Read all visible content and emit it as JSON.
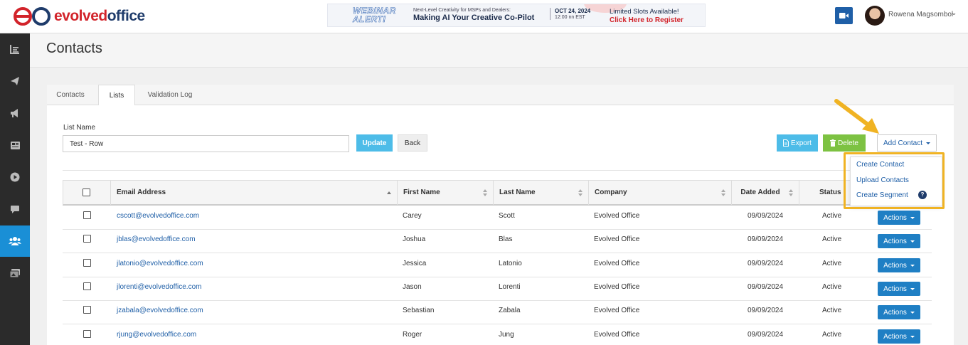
{
  "brand": {
    "part1": "evolved",
    "part2": "office"
  },
  "banner": {
    "alert_line1": "WEBINAR",
    "alert_line2": "ALERT!",
    "small_text": "Next-Level Creativity for MSPs and Dealers:",
    "headline": "Making AI Your Creative Co-Pilot",
    "date": "OCT 24, 2024",
    "time": "12:00 nn EST",
    "slots": "Limited Slots Available!",
    "cta": "Click Here to Register"
  },
  "user": {
    "name": "Rowena Magsombol"
  },
  "page": {
    "title": "Contacts"
  },
  "tabs": [
    {
      "label": "Contacts"
    },
    {
      "label": "Lists"
    },
    {
      "label": "Validation Log"
    }
  ],
  "form": {
    "list_name_label": "List Name",
    "list_name_value": "Test - Row",
    "update_label": "Update",
    "back_label": "Back"
  },
  "toolbar": {
    "export_label": "Export",
    "delete_label": "Delete",
    "add_contact_label": "Add Contact"
  },
  "dropdown": {
    "items": [
      {
        "label": "Create Contact"
      },
      {
        "label": "Upload Contacts"
      },
      {
        "label": "Create Segment"
      }
    ],
    "help": "?"
  },
  "table": {
    "columns": {
      "email": "Email Address",
      "first": "First Name",
      "last": "Last Name",
      "company": "Company",
      "date": "Date Added",
      "status": "Status"
    },
    "action_label": "Actions",
    "rows": [
      {
        "email": "cscott@evolvedoffice.com",
        "first": "Carey",
        "last": "Scott",
        "company": "Evolved Office",
        "date": "09/09/2024",
        "status": "Active"
      },
      {
        "email": "jblas@evolvedoffice.com",
        "first": "Joshua",
        "last": "Blas",
        "company": "Evolved Office",
        "date": "09/09/2024",
        "status": "Active"
      },
      {
        "email": "jlatonio@evolvedoffice.com",
        "first": "Jessica",
        "last": "Latonio",
        "company": "Evolved Office",
        "date": "09/09/2024",
        "status": "Active"
      },
      {
        "email": "jlorenti@evolvedoffice.com",
        "first": "Jason",
        "last": "Lorenti",
        "company": "Evolved Office",
        "date": "09/09/2024",
        "status": "Active"
      },
      {
        "email": "jzabala@evolvedoffice.com",
        "first": "Sebastian",
        "last": "Zabala",
        "company": "Evolved Office",
        "date": "09/09/2024",
        "status": "Active"
      },
      {
        "email": "rjung@evolvedoffice.com",
        "first": "Roger",
        "last": "Jung",
        "company": "Evolved Office",
        "date": "09/09/2024",
        "status": "Active"
      }
    ]
  },
  "colors": {
    "primary": "#1f7fc4",
    "accent_blue": "#4dbce8",
    "delete_green": "#7dc242",
    "sidebar_active": "#1a8fd6",
    "highlight": "#f0b323",
    "brand_red": "#d2232a",
    "brand_navy": "#1f3c6b"
  },
  "icons": {
    "sidebar": [
      "dashboard-icon",
      "send-icon",
      "megaphone-icon",
      "newspaper-icon",
      "play-icon",
      "chat-icon",
      "users-icon",
      "images-icon"
    ]
  }
}
